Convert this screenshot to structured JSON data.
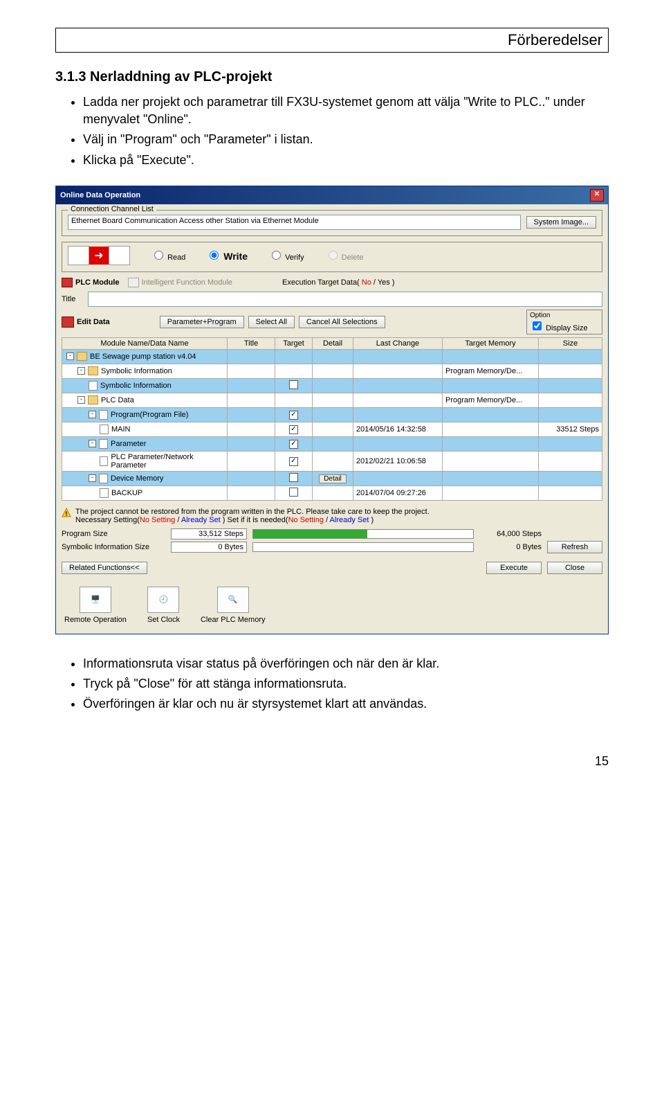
{
  "header": "Förberedelser",
  "section": "3.1.3 Nerladdning av PLC-projekt",
  "pre_bullets": [
    "Ladda ner projekt och parametrar till FX3U-systemet genom att välja \"Write to PLC..\" under menyvalet \"Online\".",
    "Välj in \"Program\" och \"Parameter\" i listan.",
    "Klicka på \"Execute\"."
  ],
  "post_bullets": [
    "Informationsruta visar status på överföringen och när den är klar.",
    "Tryck på \"Close\" för att stänga informationsruta.",
    "Överföringen är klar och nu är styrsystemet klart att användas."
  ],
  "page_number": "15",
  "dlg": {
    "title": "Online Data Operation",
    "ccl_legend": "Connection Channel List",
    "ccl_value": "Ethernet Board Communication  Access other Station via Ethernet Module",
    "system_image_btn": "System Image...",
    "modes": {
      "read": "Read",
      "write": "Write",
      "verify": "Verify",
      "delete": "Delete"
    },
    "tab1": "PLC Module",
    "tab2": "Intelligent Function Module",
    "exec_target_label": "Execution Target Data(",
    "exec_no": "No",
    "exec_slash": "/",
    "exec_yes": "Yes",
    "exec_close": ")",
    "title_label": "Title",
    "edit_data": "Edit Data",
    "btn_pp": "Parameter+Program",
    "btn_sa": "Select All",
    "btn_ca": "Cancel All Selections",
    "option_legend": "Option",
    "display_size": "Display Size",
    "cols": {
      "name": "Module Name/Data Name",
      "title": "Title",
      "target": "Target",
      "detail": "Detail",
      "last": "Last Change",
      "mem": "Target Memory",
      "size": "Size"
    },
    "rows": [
      {
        "lvl": 0,
        "name": "BE Sewage pump station v4.04",
        "exp": "-",
        "sel": true
      },
      {
        "lvl": 1,
        "name": "Symbolic Information",
        "exp": "-",
        "mem": "Program Memory/De...",
        "sel": false
      },
      {
        "lvl": 2,
        "name": "Symbolic Information",
        "exp": "",
        "target": false,
        "sel": true
      },
      {
        "lvl": 1,
        "name": "PLC Data",
        "exp": "-",
        "mem": "Program Memory/De...",
        "sel": false
      },
      {
        "lvl": 2,
        "name": "Program(Program File)",
        "exp": "-",
        "target": true,
        "sel": true
      },
      {
        "lvl": 3,
        "name": "MAIN",
        "exp": "",
        "target": true,
        "last": "2014/05/16 14:32:58",
        "size": "33512 Steps",
        "sel": false
      },
      {
        "lvl": 2,
        "name": "Parameter",
        "exp": "-",
        "target": true,
        "sel": true
      },
      {
        "lvl": 3,
        "name": "PLC Parameter/Network Parameter",
        "exp": "",
        "target": true,
        "last": "2012/02/21 10:06:58",
        "sel": false
      },
      {
        "lvl": 2,
        "name": "Device Memory",
        "exp": "-",
        "target": false,
        "detail": "Detail",
        "sel": true
      },
      {
        "lvl": 3,
        "name": "BACKUP",
        "exp": "",
        "target": false,
        "last": "2014/07/04 09:27:26",
        "sel": false
      }
    ],
    "warn1": "The project cannot be restored from the program written in the PLC. Please take care to keep the project.",
    "warn2a": "Necessary Setting(",
    "warn2b": "No Setting",
    "warn2c": " / ",
    "warn2d": "Already Set",
    "warn2e": " )    Set if it is needed(",
    "warn2f": "No Setting",
    "warn2g": " / ",
    "warn2h": "Already Set",
    "warn2i": " )",
    "prog_size_label": "Program Size",
    "prog_size_val": "33,512 Steps",
    "prog_size_max": "64,000 Steps",
    "sym_size_label": "Symbolic Information Size",
    "sym_size_val": "0 Bytes",
    "sym_size_max": "0 Bytes",
    "refresh": "Refresh",
    "related": "Related Functions<<",
    "execute": "Execute",
    "close": "Close",
    "func1": "Remote Operation",
    "func2": "Set Clock",
    "func3": "Clear PLC Memory"
  }
}
